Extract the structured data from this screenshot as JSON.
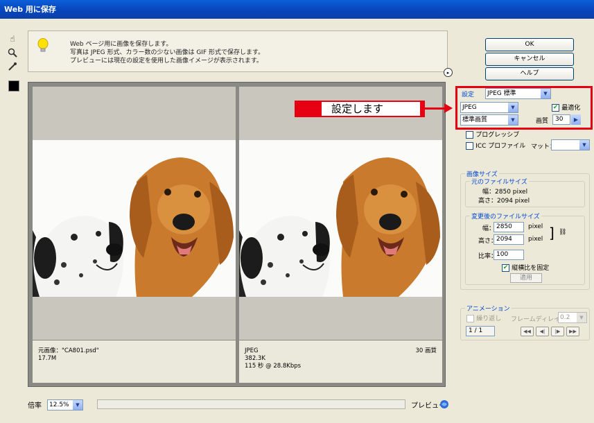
{
  "window": {
    "title": "Web 用に保存"
  },
  "tools": [
    {
      "name": "hand-tool-icon",
      "glyph": "✋"
    },
    {
      "name": "zoom-tool-icon",
      "glyph": "🔍"
    },
    {
      "name": "eyedropper-tool-icon",
      "glyph": "✎"
    }
  ],
  "info": {
    "line1": "Web ページ用に画像を保存します。",
    "line2": "写真は JPEG 形式、カラー数の少ない画像は GIF 形式で保存します。",
    "line3": "プレビューには現在の設定を使用した画像イメージが表示されます。"
  },
  "preview": {
    "left_caption1": "元画像：\"CA801.psd\"",
    "left_caption2": "17.7M",
    "right_caption1": "JPEG",
    "right_caption2": "382.3K",
    "right_caption3": "115 秒 @ 28.8Kbps",
    "right_quality": "30 画質"
  },
  "bottom": {
    "zoom_label": "倍率",
    "zoom_value": "12.5%",
    "preview_label": "プレビュー"
  },
  "buttons": {
    "ok": "OK",
    "cancel": "キャンセル",
    "help": "ヘルプ"
  },
  "settings": {
    "preset_label": "設定",
    "preset_value": "JPEG 標準",
    "format_value": "JPEG",
    "optimize_label": "最適化",
    "optimize_checked": true,
    "quality_preset": "標準画質",
    "quality_label": "画質",
    "quality_value": "30",
    "progressive_label": "プログレッシブ",
    "icc_label": "ICC プロファイル",
    "matte_label": "マット："
  },
  "callout": {
    "text": "設定します"
  },
  "image_size": {
    "group_title": "画像サイズ",
    "original_title": "元のファイルサイズ",
    "orig_width_label": "幅：",
    "orig_width": "2850 pixel",
    "orig_height_label": "高さ：",
    "orig_height": "2094 pixel",
    "new_title": "変更後のファイルサイズ",
    "new_width_label": "幅：",
    "new_width": "2850",
    "new_height_label": "高さ：",
    "new_height": "2094",
    "unit": "pixel",
    "ratio_label": "比率：",
    "ratio_value": "100",
    "constrain_label": "縦横比を固定",
    "constrain_checked": true,
    "apply_label": "適用"
  },
  "animation": {
    "group_title": "アニメーション",
    "loop_label": "繰り返し",
    "frame_delay_label": "フレームディレイ",
    "frame_delay_value": "0.2",
    "frame_counter": "1 / 1",
    "nav": [
      "◀◀",
      "◀|",
      "|▶",
      "▶▶"
    ]
  },
  "colors": {
    "accent_red": "#e60012",
    "title_blue": "#0a4fc8"
  }
}
